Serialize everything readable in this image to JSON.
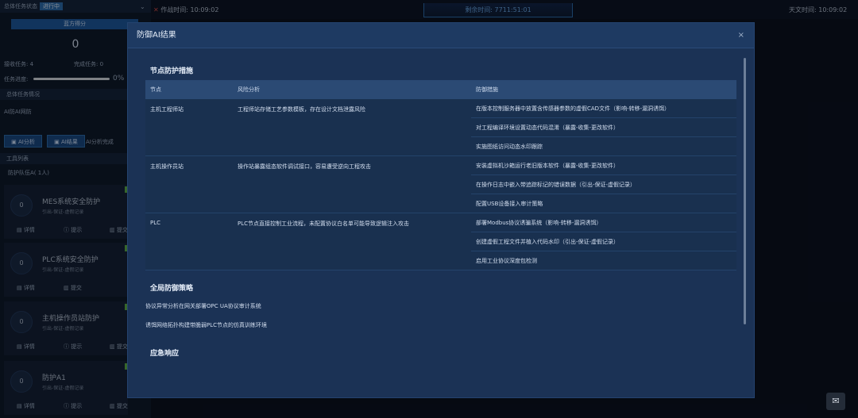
{
  "topbar": {
    "work_time": "作战时间: 10:09:02",
    "remaining_time": "剩余时间: 7711:51:01",
    "sky_time": "天文时间: 10:09:02"
  },
  "left": {
    "status_label": "总体任务状态",
    "status_badge": "进行中",
    "ribbon": "蓝方得分",
    "score": "0",
    "accepted": "接收任务: 4",
    "completed": "完成任务: 0",
    "progress_label": "任务进度:",
    "progress_value": "0%",
    "progress_fraction": 0,
    "overview": "总体任务情况",
    "ai_defense": "AI防AI网防",
    "ai_analysis_btn": "AI分析",
    "ai_result_btn": "AI结果",
    "ai_done": "AI分析完成",
    "list_title": "工具列表",
    "team": "防护队伍A( 1人)",
    "cards": [
      {
        "score": "0",
        "title": "MES系统安全防护",
        "sub": "引出-保证-虚假记录",
        "a1": "详情",
        "a2": "提示",
        "a3": "提交"
      },
      {
        "score": "0",
        "title": "PLC系统安全防护",
        "sub": "引出-保证-虚假记录",
        "a1": "详情",
        "a2": "提交",
        "a3": ""
      },
      {
        "score": "0",
        "title": "主机操作员站防护",
        "sub": "引出-保证-虚假记录",
        "a1": "详情",
        "a2": "提示",
        "a3": "提交"
      },
      {
        "score": "0",
        "title": "防护A1",
        "sub": "引出-保证-虚假记录",
        "a1": "详情",
        "a2": "提示",
        "a3": "提交"
      }
    ]
  },
  "modal": {
    "title": "防御AI结果",
    "close": "×",
    "section1": "节点防护措施",
    "headers": [
      "节点",
      "风险分析",
      "防御措施"
    ],
    "rows": [
      {
        "node": "主机工程师站",
        "risk": "工程师站存储工艺参数模板，存在设计文档泄露风险",
        "measures": [
          "在版本控制服务器中放置含传感器参数的虚假CAD文件（影响-转移-漏洞诱饵）",
          "对工程编译环境设置动态代码混淆（暴露-收集-更改软件）",
          "实施图纸访问动态水印跟踪"
        ]
      },
      {
        "node": "主机操作员站",
        "risk": "操作站暴露组态软件调试接口，容易遭受逆向工程攻击",
        "measures": [
          "安装虚拟机沙箱运行老旧版本软件（暴露-收集-更改软件）",
          "在操作日志中嵌入带追踪标记的错误数据（引出-保证-虚假记录）",
          "配置USB设备接入审计策略"
        ]
      },
      {
        "node": "PLC",
        "risk": "PLC节点直接控制工业流程，未配置协议白名单可能导致逻辑注入攻击",
        "measures": [
          "部署Modbus协议诱骗系统（影响-转移-漏洞诱饵）",
          "创建虚假工程文件并植入代码水印（引出-保证-虚假记录）",
          "启用工业协议深度包检测"
        ]
      }
    ],
    "section2": "全局防御策略",
    "global": [
      "协议异常分析在网关部署OPC UA协议审计系统",
      "诱饵网络拓扑构建带脆弱PLC节点的仿真训练环境"
    ],
    "section3": "应急响应"
  }
}
